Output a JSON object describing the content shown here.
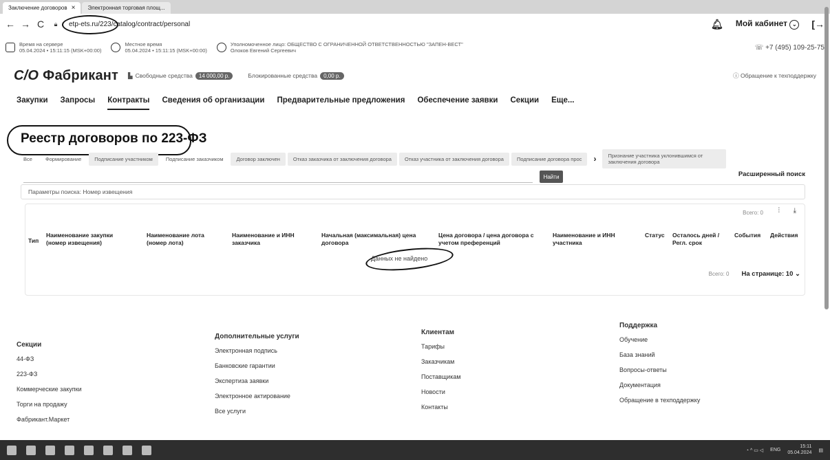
{
  "browser": {
    "tabs": [
      {
        "label": "Заключение договоров",
        "active": true
      },
      {
        "label": "Электронная торговая площ...",
        "active": false
      }
    ],
    "url": "etp-ets.ru/223/catalog/contract/personal",
    "cabinet_label": "Мой кабинет"
  },
  "info": {
    "server_time_label": "Время на сервере",
    "server_time": "05.04.2024 • 15:11:15 (MSK+00:00)",
    "local_time_label": "Местное время",
    "local_time": "05.04.2024 • 15:11:15 (MSK+00:00)",
    "org_label": "Уполномоченное лицо: ОБЩЕСТВО С ОГРАНИЧЕННОЙ ОТВЕТСТВЕННОСТЬЮ \"ЗАПЕН-ВЕСТ\"",
    "person": "Олоков Евгений Сергеевич",
    "phone": "+7 (495) 109-25-75"
  },
  "brand": {
    "logo_mark": "C/O",
    "logo_text": "Фабрикант",
    "free_funds_label": "Свободные средства",
    "free_funds_value": "14 000,00 р.",
    "blocked_funds_label": "Блокированные средства",
    "blocked_funds_value": "0,00 р.",
    "support_label": "Обращение к техподдержку"
  },
  "nav": [
    "Закупки",
    "Запросы",
    "Контракты",
    "Сведения об организации",
    "Предварительные предложения",
    "Обеспечение заявки",
    "Секции",
    "Еще..."
  ],
  "page": {
    "title": "Реестр договоров по 223-ФЗ",
    "filters": [
      "Все",
      "Формирование",
      "Подписание участником",
      "Подписание заказчиком",
      "Договор заключен",
      "Отказ заказчика от заключения договора",
      "Отказ участника от заключения договора",
      "Подписание договора прос"
    ],
    "filter_extra": "Признание участника уклонившимся от заключения договора",
    "find_button": "Найти",
    "advanced_search": "Расширенный поиск",
    "params_label": "Параметры поиска: Номер извещения"
  },
  "table": {
    "total_top": "Всего: 0",
    "headers": [
      "Тип",
      "Наименование закупки (номер извещения)",
      "Наименование лота (номер лота)",
      "Наименование и ИНН заказчика",
      "Начальная (максимальная) цена договора",
      "Цена договора / цена договора с учетом преференций",
      "Наименование и ИНН участника",
      "Статус",
      "Осталось дней / Регл. срок",
      "События",
      "Действия"
    ],
    "empty_text": "Данных не найдено",
    "total_bottom": "Всего: 0",
    "per_page": "На странице: 10"
  },
  "footer": {
    "sections_title": "Секции",
    "sections": [
      "44-ФЗ",
      "223-ФЗ",
      "Коммерческие закупки",
      "Торги на продажу",
      "Фабрикант.Маркет"
    ],
    "services_title": "Дополнительные услуги",
    "services": [
      "Электронная подпись",
      "Банковские гарантии",
      "Экспертиза заявки",
      "Электронное актирование",
      "Все услуги"
    ],
    "clients_title": "Клиентам",
    "clients": [
      "Тарифы",
      "Заказчикам",
      "Поставщикам",
      "Новости",
      "Контакты"
    ],
    "support_title": "Поддержка",
    "support": [
      "Обучение",
      "База знаний",
      "Вопросы-ответы",
      "Документация",
      "Обращение в техподдержку"
    ]
  },
  "taskbar": {
    "lang": "ENG",
    "time": "15:11",
    "date": "05.04.2024"
  }
}
